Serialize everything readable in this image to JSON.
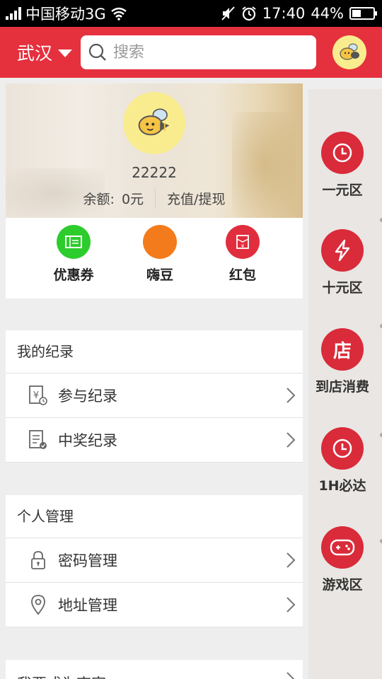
{
  "status_bar": {
    "carrier": "中国移动3G",
    "time": "17:40",
    "battery_text": "44%",
    "battery_level": 0.44
  },
  "header": {
    "city": "武汉",
    "search_placeholder": "搜索"
  },
  "profile": {
    "username": "22222",
    "balance_label": "余额:",
    "balance_value": "0元",
    "recharge_label": "充值/提现"
  },
  "quick_actions": [
    {
      "label": "优惠券",
      "color": "#2dcc2d",
      "icon": "coupon-icon"
    },
    {
      "label": "嗨豆",
      "color": "#f47b1c",
      "icon": "bean-icon"
    },
    {
      "label": "红包",
      "color": "#e02e3e",
      "icon": "red-envelope-icon"
    }
  ],
  "records": {
    "title": "我的纪录",
    "items": [
      {
        "label": "参与纪录",
        "icon": "yuan-clock-icon"
      },
      {
        "label": "中奖纪录",
        "icon": "document-check-icon"
      }
    ]
  },
  "personal": {
    "title": "个人管理",
    "items": [
      {
        "label": "密码管理",
        "icon": "lock-icon"
      },
      {
        "label": "地址管理",
        "icon": "location-pin-icon"
      }
    ]
  },
  "merchant": {
    "label": "我要成为商家"
  },
  "side_menu": [
    {
      "label": "一元区",
      "icon": "clock-icon"
    },
    {
      "label": "十元区",
      "icon": "lightning-icon"
    },
    {
      "label": "到店消费",
      "icon_text": "店",
      "icon": "shop-icon"
    },
    {
      "label": "1H必达",
      "icon": "clock-icon"
    },
    {
      "label": "游戏区",
      "icon": "gamepad-icon"
    }
  ],
  "colors": {
    "primary_red": "#e5303e",
    "side_red": "#d92b3a"
  }
}
